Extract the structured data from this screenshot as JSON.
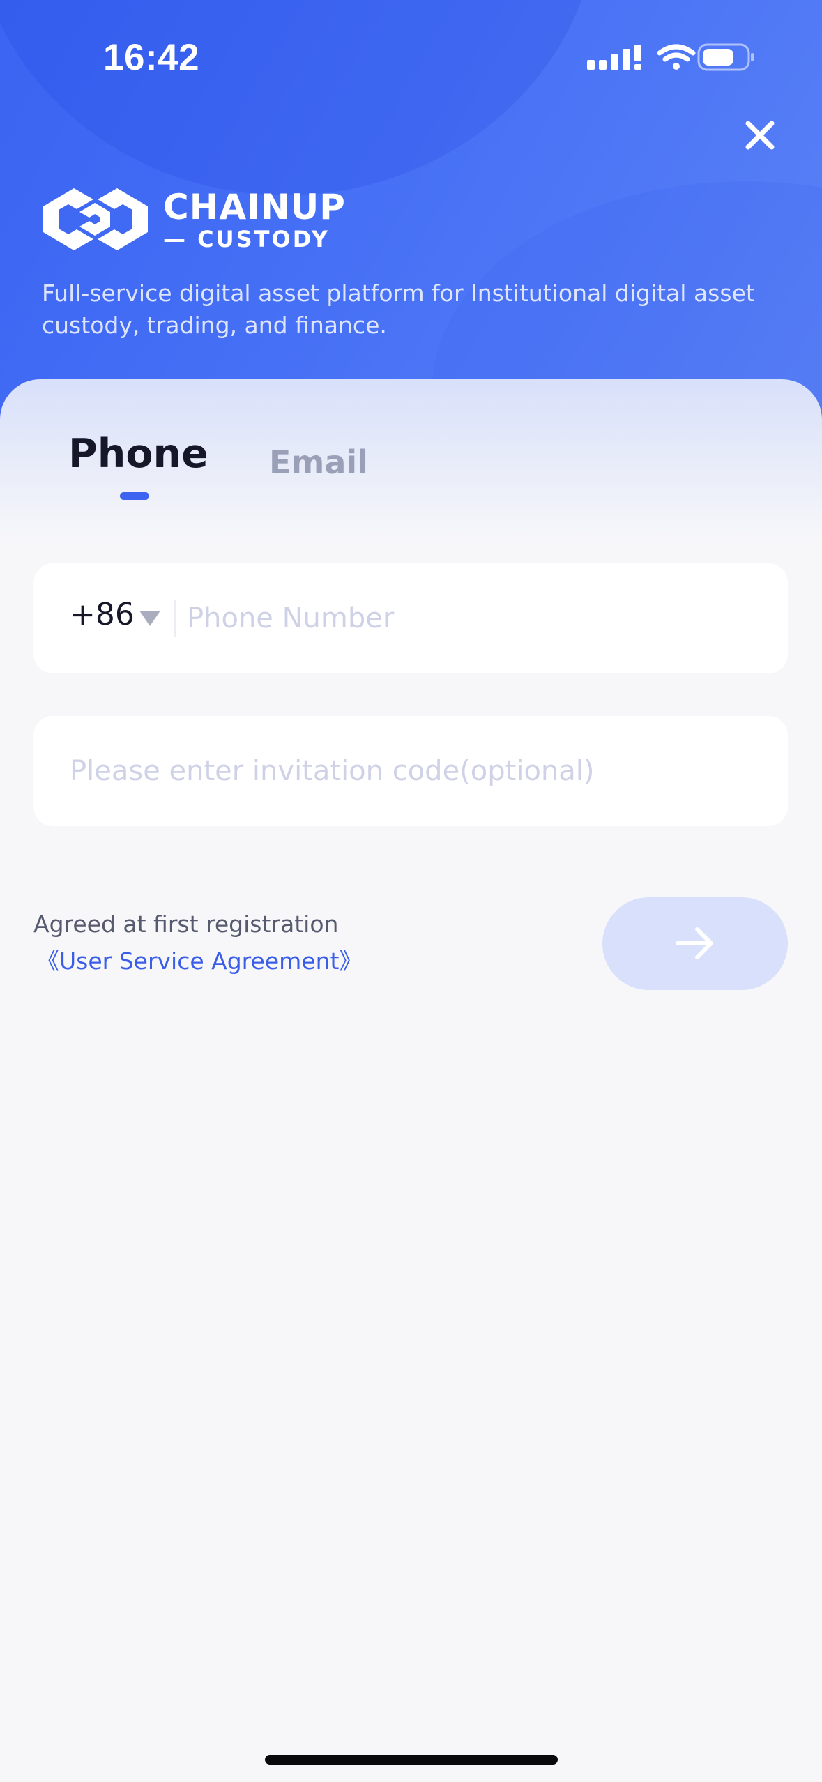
{
  "status_bar": {
    "time": "16:42",
    "icons": [
      "cellular-signal-icon",
      "wifi-icon",
      "battery-icon"
    ]
  },
  "header": {
    "close_icon": "close-icon",
    "logo": {
      "name_line1": "CHAINUP",
      "name_line2": "— CUSTODY"
    },
    "tagline": "Full-service digital asset platform for Institutional digital asset custody, trading, and finance."
  },
  "tabs": [
    {
      "label": "Phone",
      "active": true
    },
    {
      "label": "Email",
      "active": false
    }
  ],
  "form": {
    "country_code": "+86",
    "phone_placeholder": "Phone Number",
    "phone_value": "",
    "invite_placeholder": "Please enter invitation code(optional)",
    "invite_value": "",
    "agree_text": "Agreed at first registration",
    "agreement_link": "《User Service Agreement》",
    "next_icon": "arrow-right-icon"
  },
  "colors": {
    "primary": "#3d63f0",
    "link": "#3a5ee8",
    "next_button_disabled": "#d9e0fb"
  }
}
